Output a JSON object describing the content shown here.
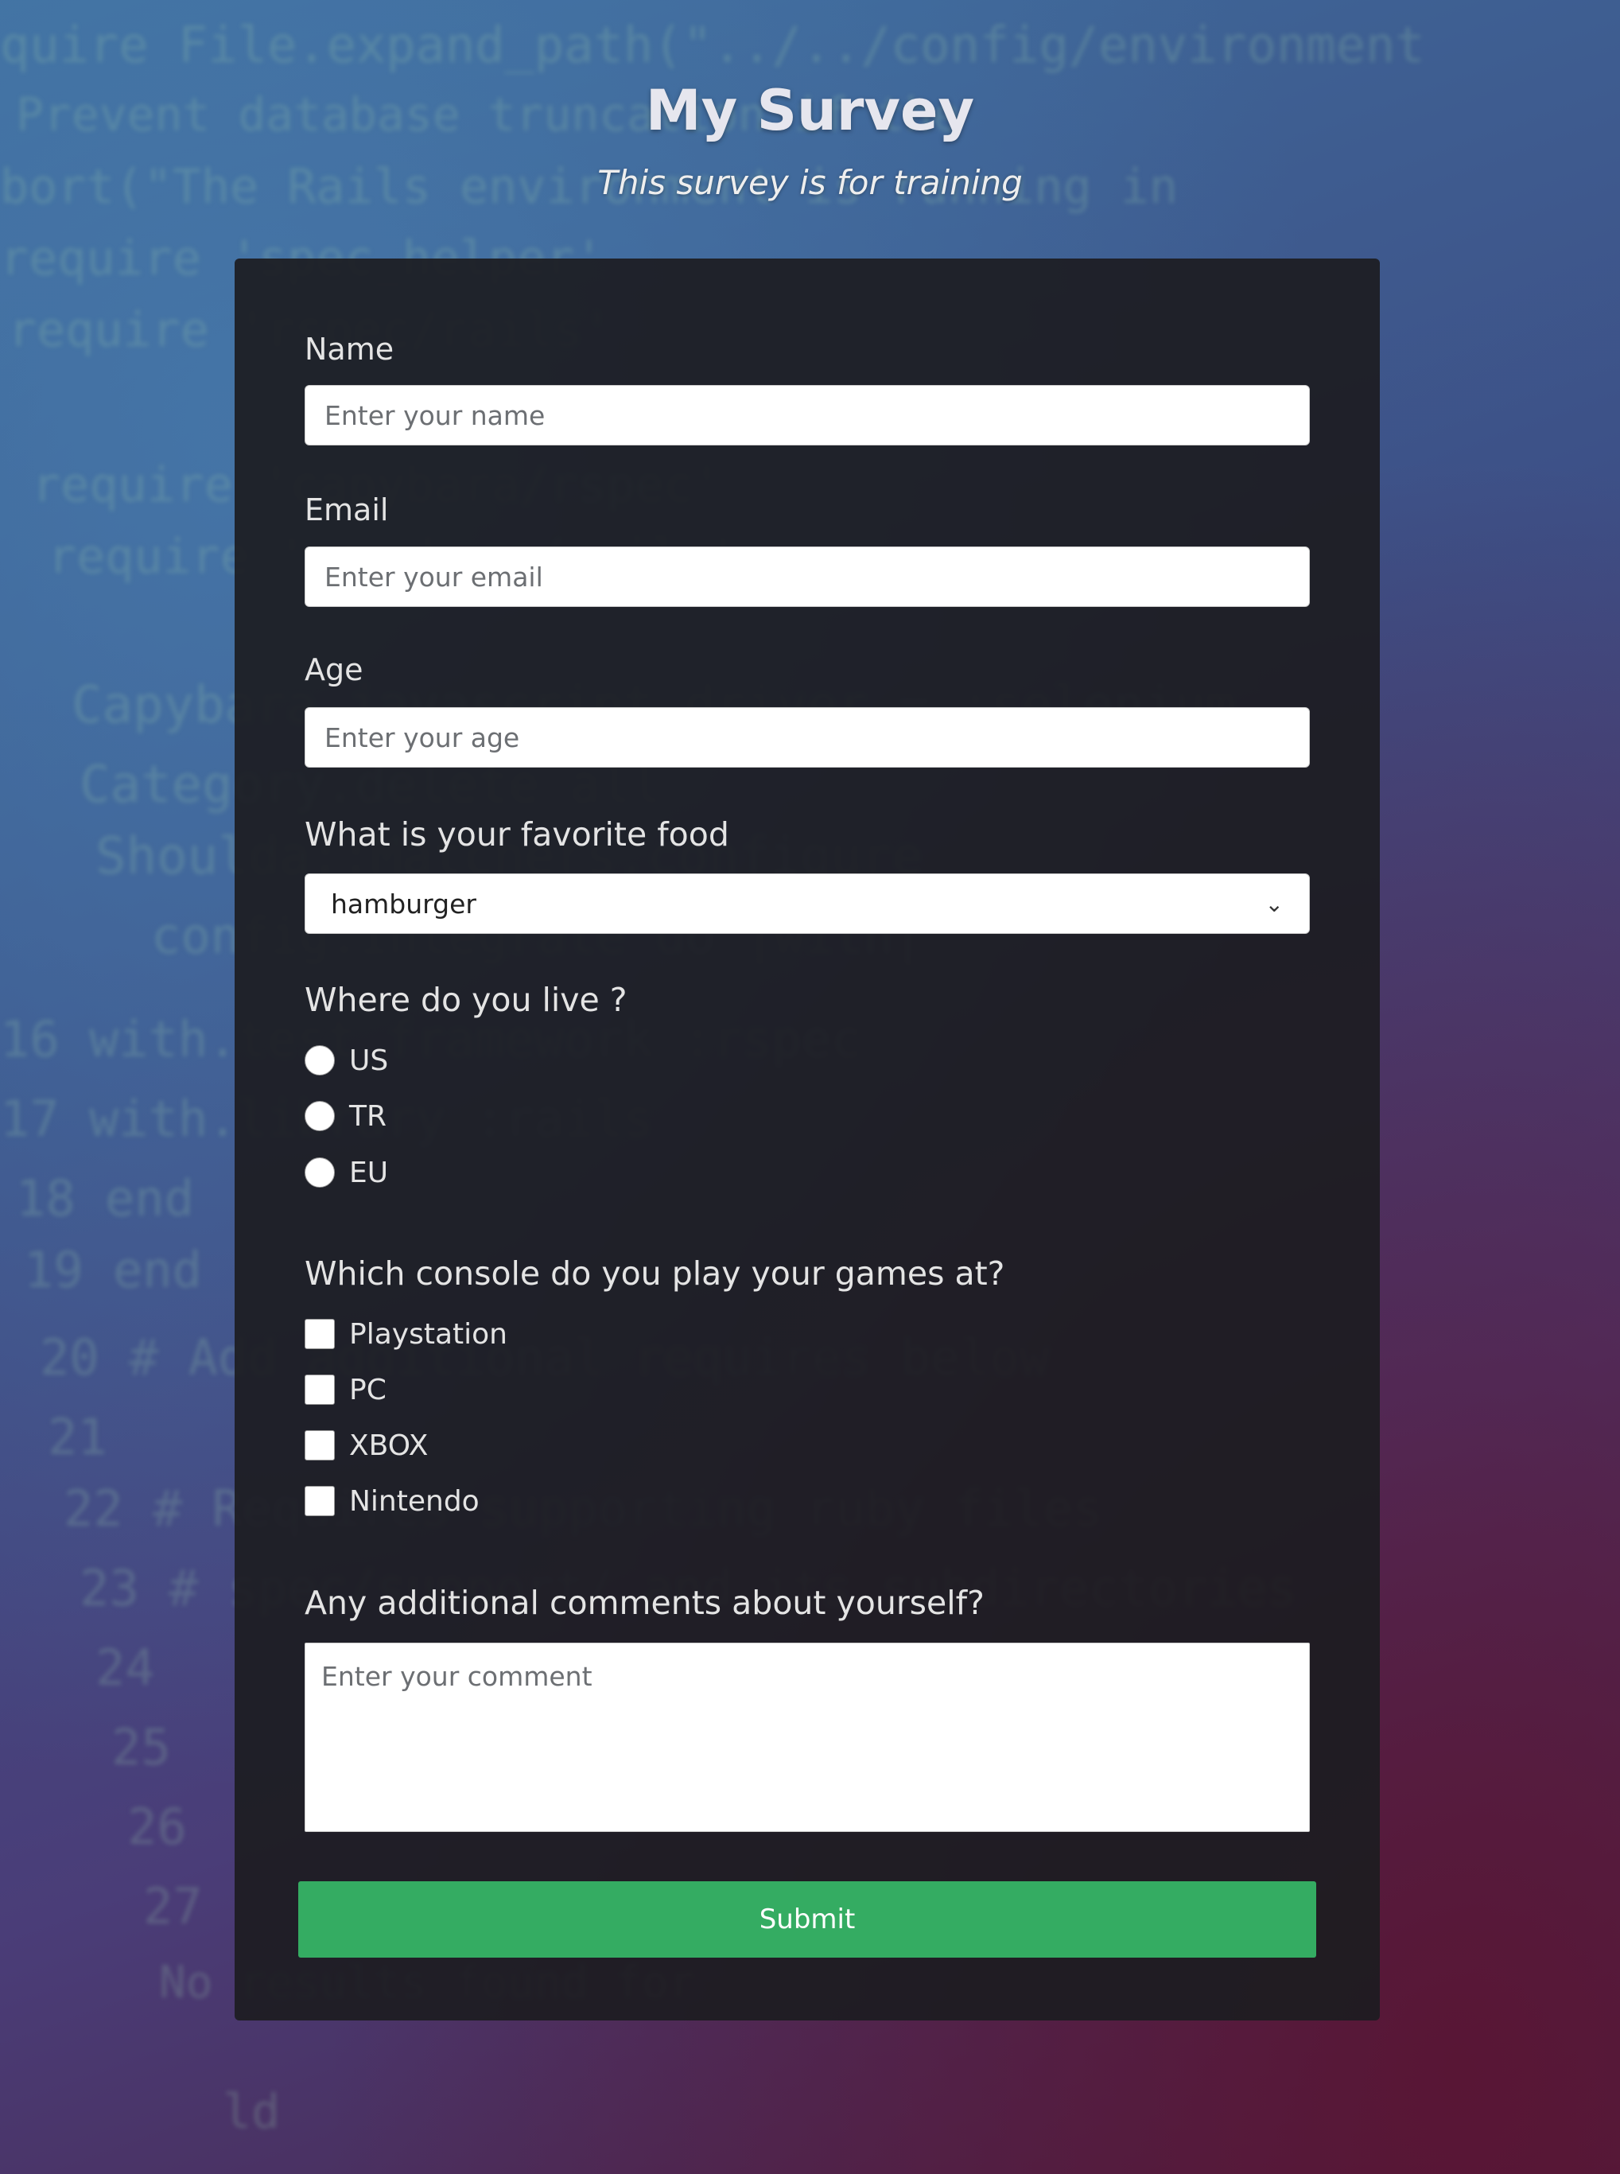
{
  "header": {
    "title": "My Survey",
    "subtitle": "This survey is for training"
  },
  "form": {
    "name": {
      "label": "Name",
      "placeholder": "Enter your name"
    },
    "email": {
      "label": "Email",
      "placeholder": "Enter your email"
    },
    "age": {
      "label": "Age",
      "placeholder": "Enter your age"
    },
    "food": {
      "question": "What is your favorite food",
      "selected": "hamburger"
    },
    "location": {
      "question": "Where do you live ?",
      "options": [
        "US",
        "TR",
        "EU"
      ]
    },
    "console": {
      "question": "Which console do you play your games at?",
      "options": [
        "Playstation",
        "PC",
        "XBOX",
        "Nintendo"
      ]
    },
    "comments": {
      "question": "Any additional comments about yourself?",
      "placeholder": "Enter your comment"
    },
    "submit_label": "Submit"
  },
  "colors": {
    "submit_button": "#34ac62",
    "card_background": "#1c1c21"
  }
}
